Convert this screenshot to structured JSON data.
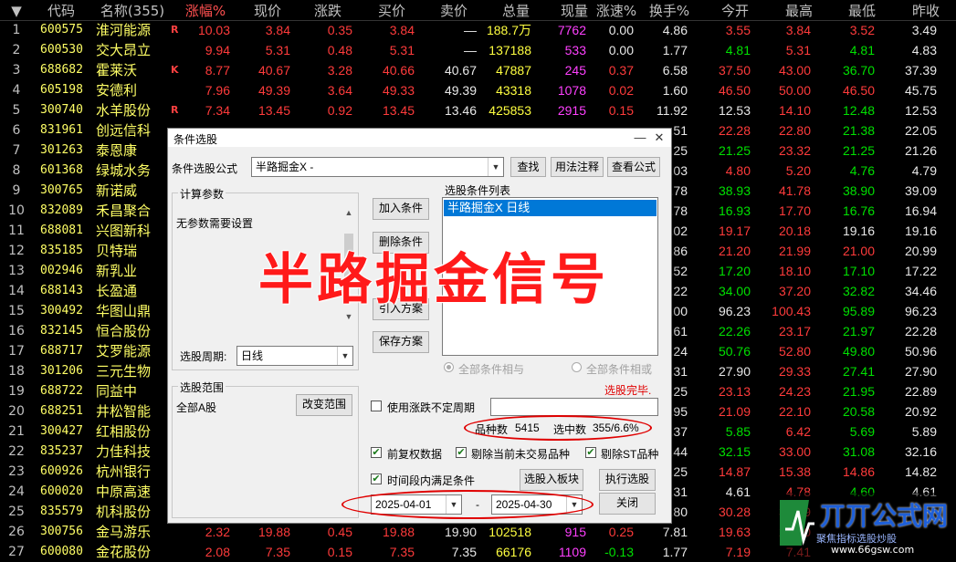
{
  "table": {
    "sort_icon": "triangle-down-icon",
    "headers": [
      "代码",
      "名称(355)",
      "涨幅%",
      "现价",
      "涨跌",
      "买价",
      "卖价",
      "总量",
      "现量",
      "涨速%",
      "换手%",
      "今开",
      "最高",
      "最低",
      "昨收"
    ],
    "rows": [
      {
        "i": "1",
        "code": "600575",
        "name": "淮河能源",
        "flag": "R",
        "pct": "10.03",
        "price": "3.84",
        "chg": "0.35",
        "bid": "3.84",
        "ask": "—",
        "vol": "188.7万",
        "cur": "7762",
        "spd": "0.00",
        "turn": "4.86",
        "open": "3.55",
        "high": "3.84",
        "low": "3.52",
        "prev": "3.49"
      },
      {
        "i": "2",
        "code": "600530",
        "name": "交大昂立",
        "flag": "",
        "pct": "9.94",
        "price": "5.31",
        "chg": "0.48",
        "bid": "5.31",
        "ask": "—",
        "vol": "137188",
        "cur": "533",
        "spd": "0.00",
        "turn": "1.77",
        "open": "4.81",
        "high": "5.31",
        "low": "4.81",
        "prev": "4.83"
      },
      {
        "i": "3",
        "code": "688682",
        "name": "霍莱沃",
        "flag": "K",
        "pct": "8.77",
        "price": "40.67",
        "chg": "3.28",
        "bid": "40.66",
        "ask": "40.67",
        "vol": "47887",
        "cur": "245",
        "spd": "0.37",
        "turn": "6.58",
        "open": "37.50",
        "high": "43.00",
        "low": "36.70",
        "prev": "37.39"
      },
      {
        "i": "4",
        "code": "605198",
        "name": "安德利",
        "flag": "",
        "pct": "7.96",
        "price": "49.39",
        "chg": "3.64",
        "bid": "49.33",
        "ask": "49.39",
        "vol": "43318",
        "cur": "1078",
        "spd": "0.02",
        "turn": "1.60",
        "open": "46.50",
        "high": "50.00",
        "low": "46.50",
        "prev": "45.75"
      },
      {
        "i": "5",
        "code": "300740",
        "name": "水羊股份",
        "flag": "R",
        "pct": "7.34",
        "price": "13.45",
        "chg": "0.92",
        "bid": "13.45",
        "ask": "13.46",
        "vol": "425853",
        "cur": "2915",
        "spd": "0.15",
        "turn": "11.92",
        "open": "12.53",
        "high": "14.10",
        "low": "12.48",
        "prev": "12.53"
      },
      {
        "i": "6",
        "code": "831961",
        "name": "创远信科",
        "flag": "",
        "pct": "",
        "price": "",
        "chg": "",
        "bid": "",
        "ask": "",
        "vol": "",
        "cur": "",
        "spd": "",
        "turn": ".51",
        "open": "22.28",
        "high": "22.80",
        "low": "21.38",
        "prev": "22.05"
      },
      {
        "i": "7",
        "code": "301263",
        "name": "泰恩康",
        "flag": "",
        "pct": "",
        "price": "",
        "chg": "",
        "bid": "",
        "ask": "",
        "vol": "",
        "cur": "",
        "spd": "",
        "turn": ".25",
        "open": "21.25",
        "high": "23.32",
        "low": "21.25",
        "prev": "21.26"
      },
      {
        "i": "8",
        "code": "601368",
        "name": "绿城水务",
        "flag": "",
        "pct": "",
        "price": "",
        "chg": "",
        "bid": "",
        "ask": "",
        "vol": "",
        "cur": "",
        "spd": "",
        "turn": ".03",
        "open": "4.80",
        "high": "5.20",
        "low": "4.76",
        "prev": "4.79"
      },
      {
        "i": "9",
        "code": "300765",
        "name": "新诺威",
        "flag": "",
        "pct": "",
        "price": "",
        "chg": "",
        "bid": "",
        "ask": "",
        "vol": "",
        "cur": "",
        "spd": "",
        "turn": ".78",
        "open": "38.93",
        "high": "41.78",
        "low": "38.90",
        "prev": "39.09"
      },
      {
        "i": "10",
        "code": "832089",
        "name": "禾昌聚合",
        "flag": "",
        "pct": "",
        "price": "",
        "chg": "",
        "bid": "",
        "ask": "",
        "vol": "",
        "cur": "",
        "spd": "",
        "turn": ".78",
        "open": "16.93",
        "high": "17.70",
        "low": "16.76",
        "prev": "16.94"
      },
      {
        "i": "11",
        "code": "688081",
        "name": "兴图新科",
        "flag": "",
        "pct": "",
        "price": "",
        "chg": "",
        "bid": "",
        "ask": "",
        "vol": "",
        "cur": "",
        "spd": "",
        "turn": ".02",
        "open": "19.17",
        "high": "20.18",
        "low": "19.16",
        "prev": "19.16"
      },
      {
        "i": "12",
        "code": "835185",
        "name": "贝特瑞",
        "flag": "",
        "pct": "",
        "price": "",
        "chg": "",
        "bid": "",
        "ask": "",
        "vol": "",
        "cur": "",
        "spd": "",
        "turn": ".86",
        "open": "21.20",
        "high": "21.99",
        "low": "21.00",
        "prev": "20.99"
      },
      {
        "i": "13",
        "code": "002946",
        "name": "新乳业",
        "flag": "",
        "pct": "",
        "price": "",
        "chg": "",
        "bid": "",
        "ask": "",
        "vol": "",
        "cur": "",
        "spd": "",
        "turn": ".52",
        "open": "17.20",
        "high": "18.10",
        "low": "17.10",
        "prev": "17.22"
      },
      {
        "i": "14",
        "code": "688143",
        "name": "长盈通",
        "flag": "",
        "pct": "",
        "price": "",
        "chg": "",
        "bid": "",
        "ask": "",
        "vol": "",
        "cur": "",
        "spd": "",
        "turn": ".22",
        "open": "34.00",
        "high": "37.20",
        "low": "32.82",
        "prev": "34.46"
      },
      {
        "i": "15",
        "code": "300492",
        "name": "华图山鼎",
        "flag": "",
        "pct": "",
        "price": "",
        "chg": "",
        "bid": "",
        "ask": "",
        "vol": "",
        "cur": "",
        "spd": "",
        "turn": ".00",
        "open": "96.23",
        "high": "100.43",
        "low": "95.89",
        "prev": "96.23"
      },
      {
        "i": "16",
        "code": "832145",
        "name": "恒合股份",
        "flag": "",
        "pct": "",
        "price": "",
        "chg": "",
        "bid": "",
        "ask": "",
        "vol": "",
        "cur": "",
        "spd": "",
        "turn": ".61",
        "open": "22.26",
        "high": "23.17",
        "low": "21.97",
        "prev": "22.28"
      },
      {
        "i": "17",
        "code": "688717",
        "name": "艾罗能源",
        "flag": "",
        "pct": "",
        "price": "",
        "chg": "",
        "bid": "",
        "ask": "",
        "vol": "",
        "cur": "",
        "spd": "",
        "turn": ".24",
        "open": "50.76",
        "high": "52.80",
        "low": "49.80",
        "prev": "50.96"
      },
      {
        "i": "18",
        "code": "301206",
        "name": "三元生物",
        "flag": "",
        "pct": "",
        "price": "",
        "chg": "",
        "bid": "",
        "ask": "",
        "vol": "",
        "cur": "",
        "spd": "",
        "turn": ".31",
        "open": "27.90",
        "high": "29.33",
        "low": "27.41",
        "prev": "27.90"
      },
      {
        "i": "19",
        "code": "688722",
        "name": "同益中",
        "flag": "",
        "pct": "",
        "price": "",
        "chg": "",
        "bid": "",
        "ask": "",
        "vol": "",
        "cur": "",
        "spd": "",
        "turn": ".25",
        "open": "23.13",
        "high": "24.23",
        "low": "21.95",
        "prev": "22.89"
      },
      {
        "i": "20",
        "code": "688251",
        "name": "井松智能",
        "flag": "",
        "pct": "",
        "price": "",
        "chg": "",
        "bid": "",
        "ask": "",
        "vol": "",
        "cur": "",
        "spd": "",
        "turn": ".95",
        "open": "21.09",
        "high": "22.10",
        "low": "20.58",
        "prev": "20.92"
      },
      {
        "i": "21",
        "code": "300427",
        "name": "红相股份",
        "flag": "",
        "pct": "",
        "price": "",
        "chg": "",
        "bid": "",
        "ask": "",
        "vol": "",
        "cur": "",
        "spd": "",
        "turn": ".37",
        "open": "5.85",
        "high": "6.42",
        "low": "5.69",
        "prev": "5.89"
      },
      {
        "i": "22",
        "code": "835237",
        "name": "力佳科技",
        "flag": "",
        "pct": "",
        "price": "",
        "chg": "",
        "bid": "",
        "ask": "",
        "vol": "",
        "cur": "",
        "spd": "",
        "turn": ".44",
        "open": "32.15",
        "high": "33.00",
        "low": "31.08",
        "prev": "32.16"
      },
      {
        "i": "23",
        "code": "600926",
        "name": "杭州银行",
        "flag": "",
        "pct": "",
        "price": "",
        "chg": "",
        "bid": "",
        "ask": "",
        "vol": "",
        "cur": "",
        "spd": "",
        "turn": ".25",
        "open": "14.87",
        "high": "15.38",
        "low": "14.86",
        "prev": "14.82"
      },
      {
        "i": "24",
        "code": "600020",
        "name": "中原高速",
        "flag": "",
        "pct": "",
        "price": "",
        "chg": "",
        "bid": "",
        "ask": "",
        "vol": "",
        "cur": "",
        "spd": "",
        "turn": ".31",
        "open": "4.61",
        "high": "4.78",
        "low": "4.60",
        "prev": "4.61"
      },
      {
        "i": "25",
        "code": "835579",
        "name": "机科股份",
        "flag": "",
        "pct": "",
        "price": "",
        "chg": "",
        "bid": "",
        "ask": "",
        "vol": "",
        "cur": "",
        "spd": "",
        "turn": ".80",
        "open": "30.28",
        "high": "31.59",
        "low": "",
        "prev": ""
      },
      {
        "i": "26",
        "code": "300756",
        "name": "金马游乐",
        "flag": "",
        "pct": "2.32",
        "price": "19.88",
        "chg": "0.45",
        "bid": "19.88",
        "ask": "19.90",
        "vol": "102518",
        "cur": "915",
        "spd": "0.25",
        "turn": "7.81",
        "open": "19.63",
        "high": "20.20",
        "low": "",
        "prev": ""
      },
      {
        "i": "27",
        "code": "600080",
        "name": "金花股份",
        "flag": "",
        "pct": "2.08",
        "price": "7.35",
        "chg": "0.15",
        "bid": "7.35",
        "ask": "7.35",
        "vol": "66176",
        "cur": "1109",
        "spd": "-0.13",
        "turn": "1.77",
        "open": "7.19",
        "high": "7.41",
        "low": "",
        "prev": ""
      }
    ]
  },
  "dialog": {
    "title": "条件选股",
    "close_icon": "close-icon",
    "minimize_icon": "minimize-icon",
    "formula_label": "条件选股公式",
    "formula_value": "半路掘金X  -",
    "find_btn": "查找",
    "usage_btn": "用法注释",
    "view_formula_btn": "查看公式",
    "calc_params_title": "计算参数",
    "no_params_text": "无参数需要设置",
    "add_condition_btn": "加入条件",
    "delete_condition_btn": "删除条件",
    "import_plan_btn": "引入方案",
    "save_plan_btn": "保存方案",
    "condition_list_title": "选股条件列表",
    "condition_list_items": [
      "半路掘金X  日线"
    ],
    "period_label": "选股周期:",
    "period_value": "日线",
    "radio_and": "全部条件相与",
    "radio_or": "全部条件相或",
    "status_text": "选股完毕.",
    "range_title": "选股范围",
    "range_value": "全部A股",
    "change_range_btn": "改变范围",
    "use_uncertain_period": "使用涨跌不定周期",
    "variety_count_label": "品种数",
    "variety_count": "5415",
    "selected_label": "选中数",
    "selected_value": "355/6.6%",
    "pre_adjust": "前复权数据",
    "exclude_untraded": "剔除当前未交易品种",
    "exclude_st": "剔除ST品种",
    "time_range_cond": "时间段内满足条件",
    "to_board_btn": "选股入板块",
    "run_btn": "执行选股",
    "date_from": "2025-04-01",
    "date_sep": "-",
    "date_to": "2025-04-30",
    "close_btn": "关闭"
  },
  "overlay_text": "半路掘金信号",
  "logo": {
    "text": "丌丌公式网",
    "slogan": "聚焦指标选股炒股",
    "url": "www.66gsw.com"
  },
  "colors": {
    "up": "#ff3b3b",
    "down": "#00e000",
    "code": "#ffff66",
    "selection": "#0078d7",
    "annotation": "#e00000"
  }
}
